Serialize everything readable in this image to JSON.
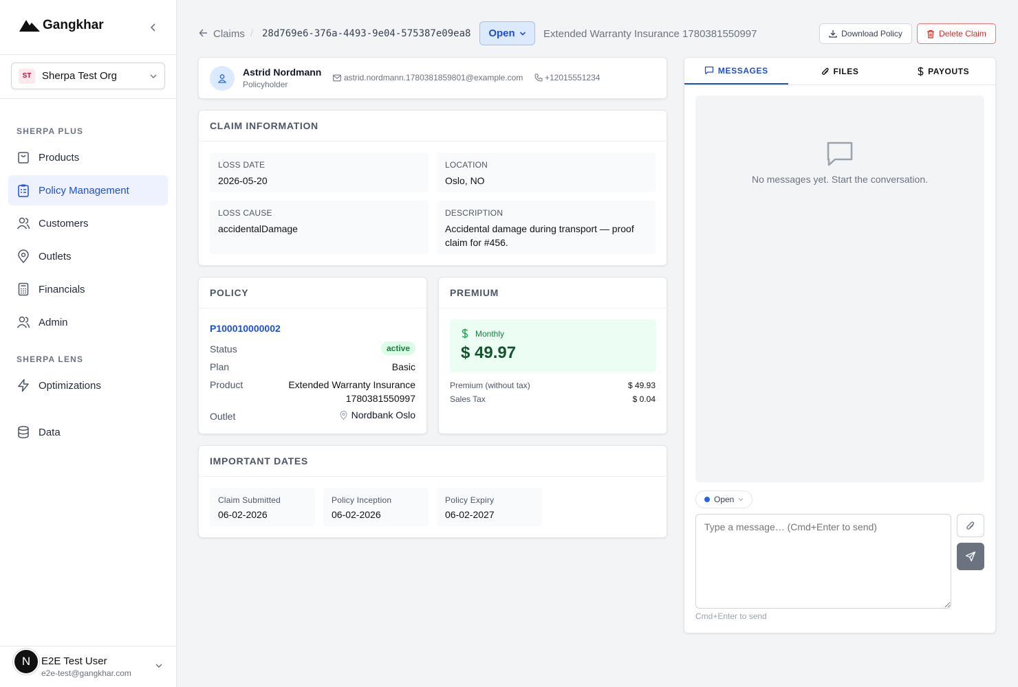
{
  "brand": {
    "name": "Gangkhar"
  },
  "org": {
    "badge": "ST",
    "name": "Sherpa Test Org"
  },
  "sidebar": {
    "section1": "SHERPA PLUS",
    "section2": "SHERPA LENS",
    "items": [
      {
        "label": "Products",
        "icon": "shopping-bag-icon"
      },
      {
        "label": "Policy Management",
        "icon": "clipboard-list-icon",
        "active": true
      },
      {
        "label": "Customers",
        "icon": "users-icon"
      },
      {
        "label": "Outlets",
        "icon": "map-pin-icon"
      },
      {
        "label": "Financials",
        "icon": "calculator-icon"
      },
      {
        "label": "Admin",
        "icon": "user-cog-icon"
      },
      {
        "label": "Optimizations",
        "icon": "zap-icon"
      },
      {
        "label": "Data",
        "icon": "database-icon"
      }
    ]
  },
  "user": {
    "initial": "N",
    "name": "E2E Test User",
    "email": "e2e-test@gangkhar.com"
  },
  "header": {
    "breadcrumb": "Claims",
    "separator": "/",
    "claim_id": "28d769e6-376a-4493-9e04-575387e09ea8",
    "status": "Open",
    "product": "Extended Warranty Insurance 1780381550997",
    "download_label": "Download Policy",
    "delete_label": "Delete Claim"
  },
  "policyholder": {
    "name": "Astrid Nordmann",
    "role": "Policyholder",
    "email": "astrid.nordmann.1780381859801@example.com",
    "phone": "+12015551234"
  },
  "claim_info": {
    "title": "CLAIM INFORMATION",
    "loss_date_label": "LOSS DATE",
    "loss_date": "2026-05-20",
    "location_label": "LOCATION",
    "location": "Oslo, NO",
    "loss_cause_label": "LOSS CAUSE",
    "loss_cause": "accidentalDamage",
    "description_label": "DESCRIPTION",
    "description": "Accidental damage during transport — proof claim for #456."
  },
  "policy": {
    "title": "POLICY",
    "number": "P100010000002",
    "status_label": "Status",
    "status": "active",
    "plan_label": "Plan",
    "plan": "Basic",
    "product_label": "Product",
    "product": "Extended Warranty Insurance 1780381550997",
    "outlet_label": "Outlet",
    "outlet": "Nordbank Oslo"
  },
  "premium": {
    "title": "PREMIUM",
    "period": "Monthly",
    "amount": "$ 49.97",
    "without_tax_label": "Premium (without tax)",
    "without_tax": "$ 49.93",
    "tax_label": "Sales Tax",
    "tax": "$ 0.04"
  },
  "dates": {
    "title": "IMPORTANT DATES",
    "items": [
      {
        "label": "Claim Submitted",
        "value": "06-02-2026"
      },
      {
        "label": "Policy Inception",
        "value": "06-02-2026"
      },
      {
        "label": "Policy Expiry",
        "value": "06-02-2027"
      }
    ]
  },
  "panel": {
    "tabs": [
      "MESSAGES",
      "FILES",
      "PAYOUTS"
    ],
    "empty": "No messages yet. Start the conversation.",
    "status": "Open",
    "placeholder": "Type a message… (Cmd+Enter to send)",
    "hint": "Cmd+Enter to send"
  },
  "colors": {
    "accent": "#1d4ed8",
    "danger": "#dc2626",
    "success": "#15803d"
  }
}
